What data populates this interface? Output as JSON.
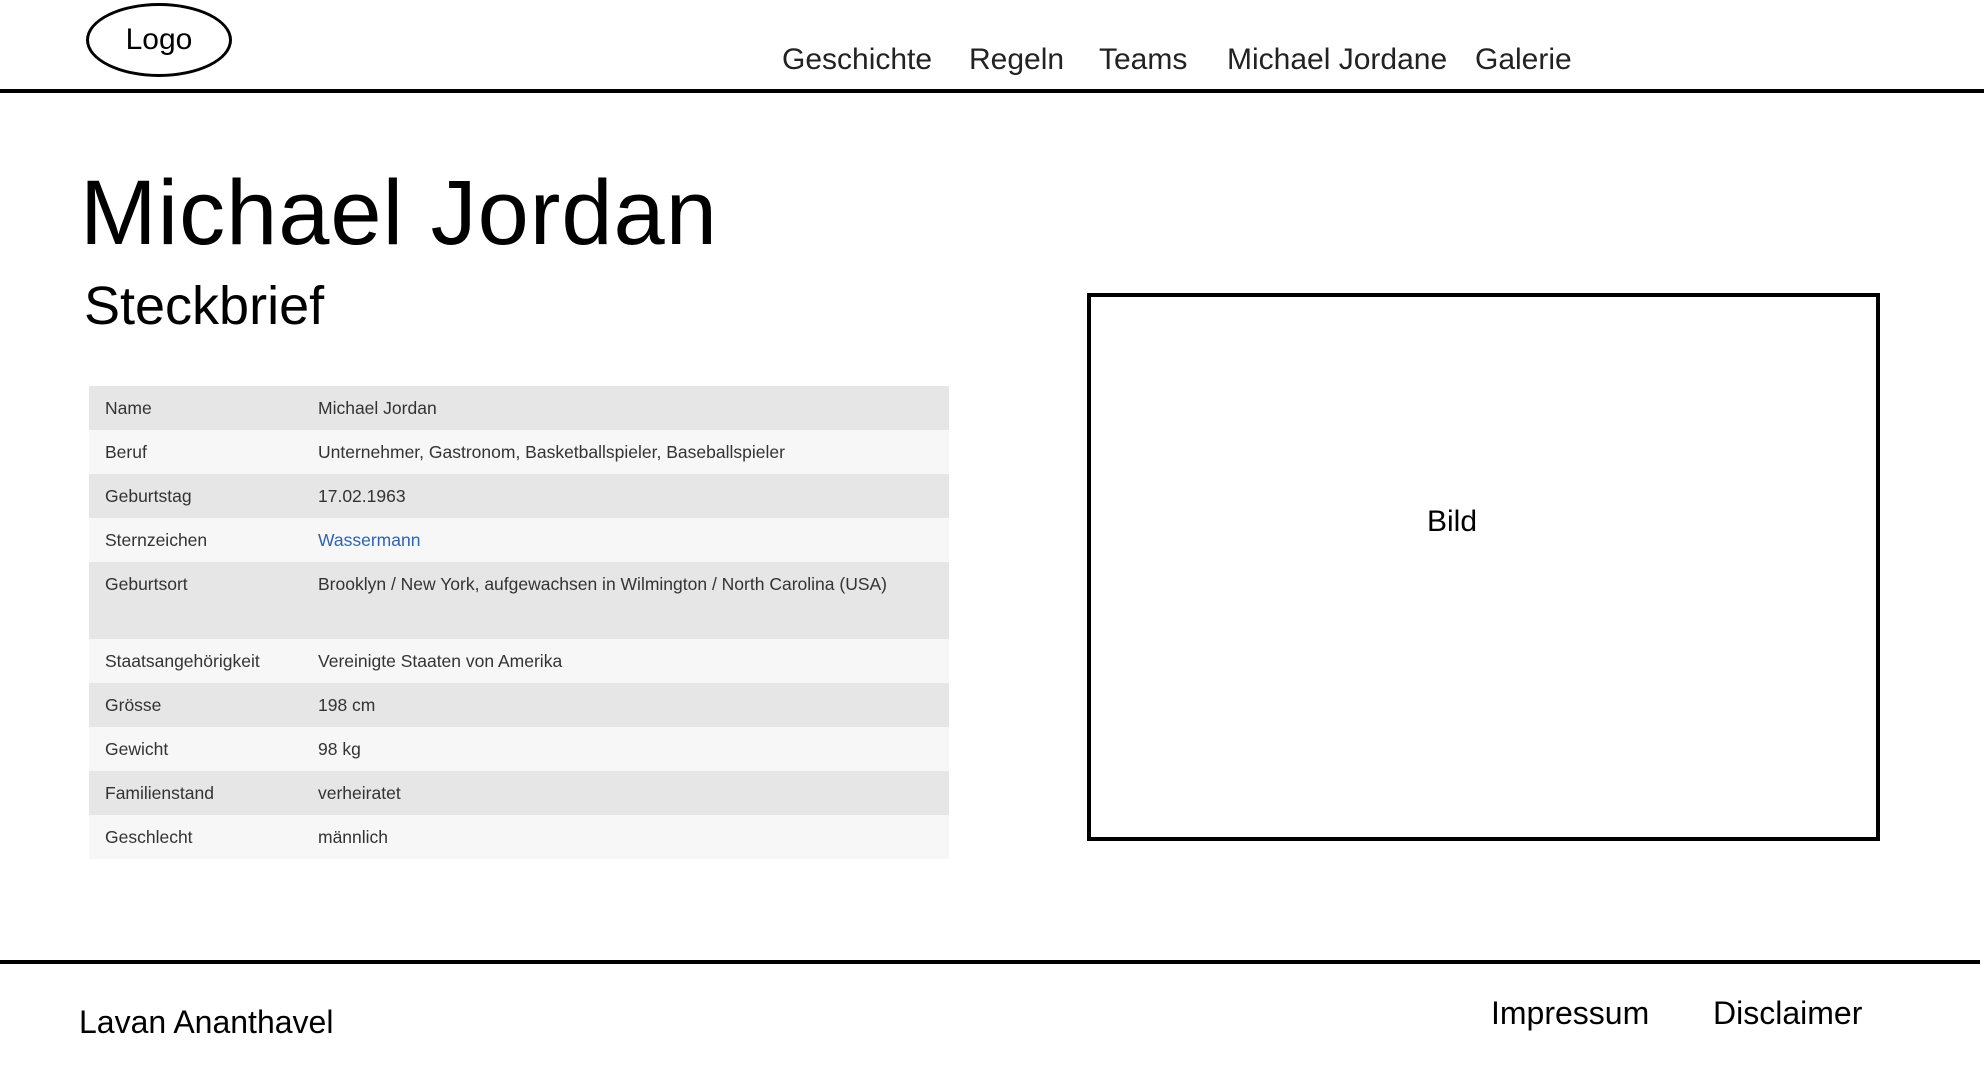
{
  "header": {
    "logo_label": "Logo",
    "nav": [
      {
        "label": "Geschichte"
      },
      {
        "label": "Regeln"
      },
      {
        "label": "Teams"
      },
      {
        "label": "Michael Jordane"
      },
      {
        "label": "Galerie"
      }
    ]
  },
  "main": {
    "title": "Michael Jordan",
    "section_title": "Steckbrief",
    "profile": [
      {
        "key": "Name",
        "value": "Michael Jordan"
      },
      {
        "key": "Beruf",
        "value": "Unternehmer, Gastronom, Basketballspieler, Baseballspieler"
      },
      {
        "key": "Geburtstag",
        "value": "17.02.1963"
      },
      {
        "key": "Sternzeichen",
        "value": "Wassermann"
      },
      {
        "key": "Geburtsort",
        "value": "Brooklyn / New York, aufgewachsen in Wilmington / North Carolina (USA)"
      },
      {
        "key": "Staatsangehörigkeit",
        "value": "Vereinigte Staaten von Amerika"
      },
      {
        "key": "Grösse",
        "value": "198 cm"
      },
      {
        "key": "Gewicht",
        "value": "98 kg"
      },
      {
        "key": "Familienstand",
        "value": "verheiratet"
      },
      {
        "key": "Geschlecht",
        "value": "männlich"
      }
    ],
    "link_color": "#2f63b2",
    "image_placeholder": "Bild"
  },
  "footer": {
    "author": "Lavan Ananthavel",
    "links": [
      {
        "label": "Impressum"
      },
      {
        "label": "Disclaimer"
      }
    ]
  }
}
